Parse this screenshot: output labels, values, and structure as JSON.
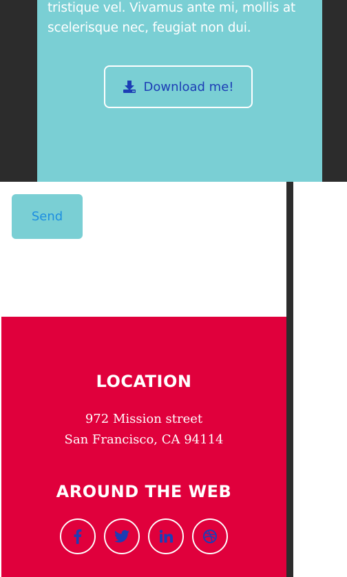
{
  "header_card": {
    "text": "tristique vel. Vivamus ante mi, mollis at scelerisque nec, feugiat non dui.",
    "download_label": "Download me!"
  },
  "form": {
    "send_label": "Send"
  },
  "footer": {
    "location_title": "LOCATION",
    "address_line1": "972 Mission street",
    "address_line2": "San Francisco, CA 94114",
    "web_title": "AROUND THE WEB",
    "social": [
      "facebook-icon",
      "twitter-icon",
      "linkedin-icon",
      "dribbble-icon"
    ]
  },
  "colors": {
    "teal": "#7acfd4",
    "red": "#e0003c",
    "dark": "#2c2c2c",
    "link_blue": "#1c3db5"
  }
}
